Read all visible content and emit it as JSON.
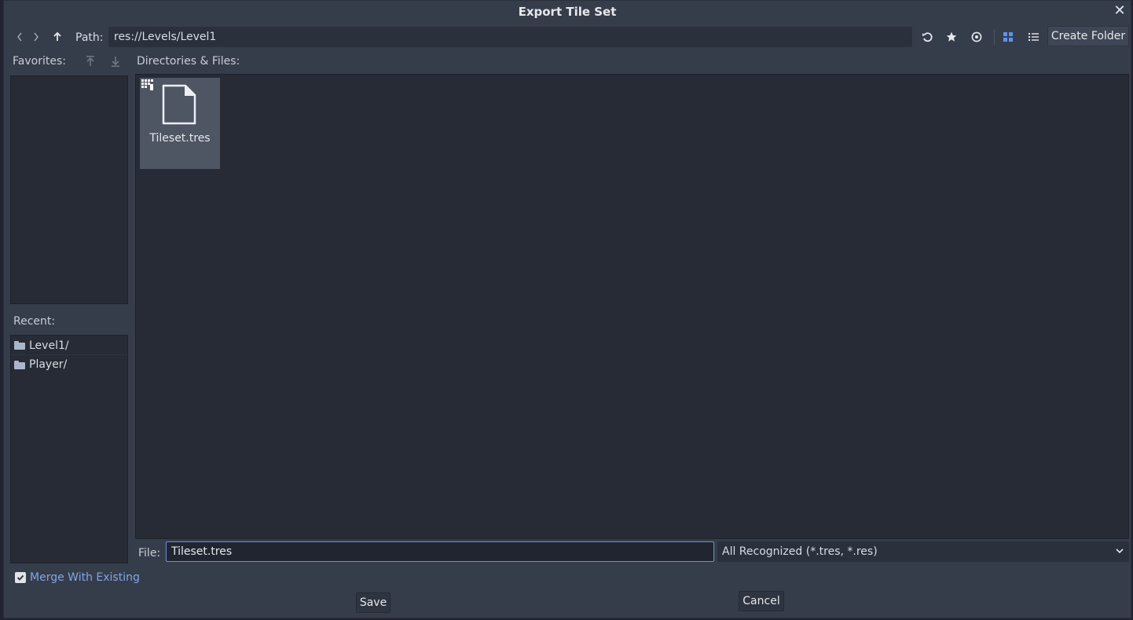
{
  "window": {
    "title": "Export Tile Set"
  },
  "toolbar": {
    "path_label": "Path:",
    "path_value": "res://Levels/Level1",
    "create_folder_label": "Create Folder"
  },
  "favorites": {
    "label": "Favorites:"
  },
  "recent": {
    "label": "Recent:",
    "items": [
      {
        "label": "Level1/"
      },
      {
        "label": "Player/"
      }
    ]
  },
  "files": {
    "label": "Directories & Files:",
    "items": [
      {
        "name": "Tileset.tres",
        "selected": true
      }
    ]
  },
  "file_row": {
    "label": "File:",
    "value": "Tileset.tres",
    "filter": "All Recognized (*.tres, *.res)"
  },
  "options": {
    "merge_label": "Merge With Existing",
    "merge_checked": true
  },
  "actions": {
    "save_label": "Save",
    "cancel_label": "Cancel"
  },
  "colors": {
    "background": "#363d4a",
    "panel": "#262b36",
    "accent": "#6a8fd8",
    "selected_item": "#4f5663"
  }
}
